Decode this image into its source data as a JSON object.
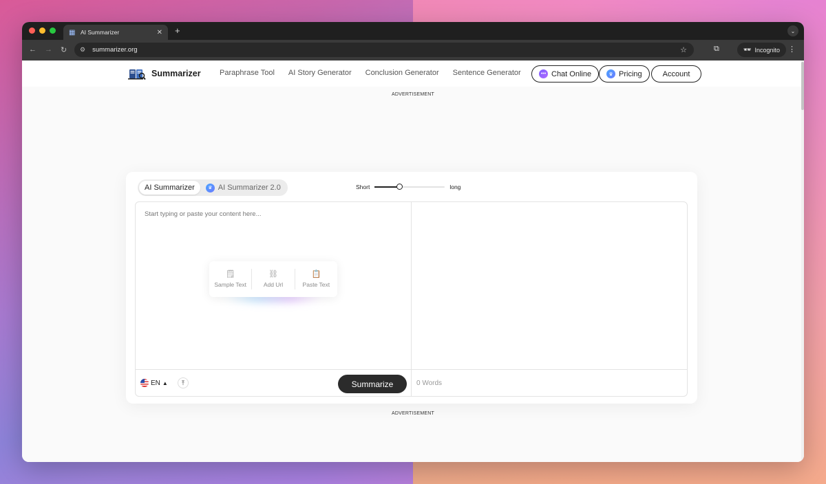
{
  "browser": {
    "tab_title": "AI Summarizer",
    "url": "summarizer.org",
    "incognito_label": "Incognito",
    "icons": [
      "back-arrow-icon",
      "forward-arrow-icon",
      "reload-icon",
      "star-icon",
      "extensions-icon",
      "incognito-icon",
      "menu-icon"
    ]
  },
  "header": {
    "logo_text": "Summarizer",
    "nav": [
      "Paraphrase Tool",
      "AI Story Generator",
      "Conclusion Generator",
      "Sentence Generator"
    ],
    "chat_label": "Chat Online",
    "pricing_label": "Pricing",
    "account_label": "Account"
  },
  "ads": {
    "top": "ADVERTISEMENT",
    "bottom": "ADVERTISEMENT"
  },
  "tool": {
    "modes": [
      "AI Summarizer",
      "AI Summarizer 2.0"
    ],
    "active_mode": "AI Summarizer",
    "length_short": "Short",
    "length_long": "long",
    "length_value": 0.35,
    "placeholder": "Start typing or paste your content here...",
    "quick_actions": [
      "Sample Text",
      "Add Url",
      "Paste Text"
    ],
    "language": "EN",
    "summarize_label": "Summarize",
    "word_count": "0 Words"
  },
  "colors": {
    "accent_dark": "#2b2b2b",
    "chat_icon": "#7c5cff",
    "pricing_icon": "#4aa3ff"
  }
}
